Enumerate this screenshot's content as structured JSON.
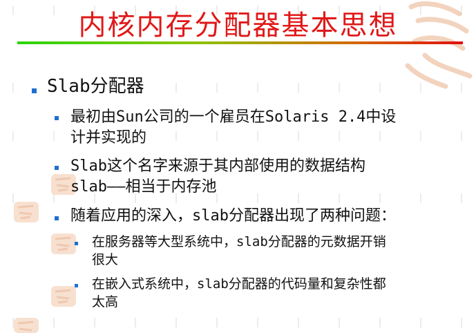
{
  "slide": {
    "title": "内核内存分配器基本思想",
    "colors": {
      "title": "#e01818",
      "bullet": "#1f6fd0",
      "text": "#111111"
    },
    "level1": {
      "text": "Slab分配器"
    },
    "level2": [
      {
        "lines": [
          "最初由Sun公司的一个雇员在Solaris 2.4中设",
          "计并实现的"
        ]
      },
      {
        "lines": [
          "Slab这个名字来源于其内部使用的数据结构",
          "slab——相当于内存池"
        ]
      },
      {
        "lines": [
          "随着应用的深入，slab分配器出现了两种问题："
        ]
      }
    ],
    "level3": [
      {
        "lines": [
          "在服务器等大型系统中，slab分配器的元数据开销",
          "很大"
        ]
      },
      {
        "lines": [
          "在嵌入式系统中，slab分配器的代码量和复杂性都",
          "太高"
        ]
      }
    ]
  }
}
